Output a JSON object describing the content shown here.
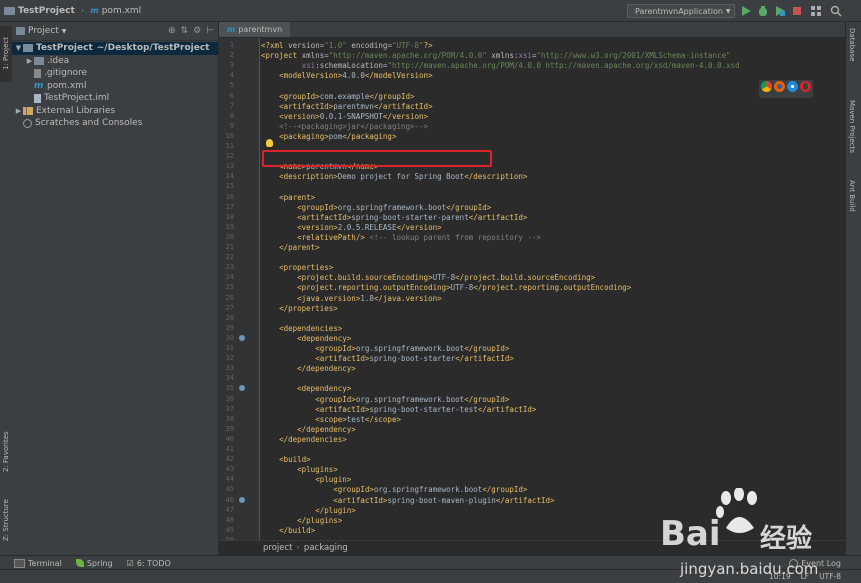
{
  "titlebar": {
    "project": "TestProject",
    "file": "pom.xml",
    "run_config": "ParentmvnApplication"
  },
  "left_strip": {
    "project_tab": "1: Project",
    "favorites_tab": "2: Favorites",
    "structure_tab": "Z: Structure"
  },
  "right_strip": {
    "database": "Database",
    "maven": "Maven Projects",
    "ant": "Ant Build"
  },
  "project_panel": {
    "title": "Project",
    "tree": [
      {
        "label": "TestProject",
        "suffix": "~/Desktop/TestProject",
        "indent": 0,
        "expanded": true,
        "icon": "folder-icon",
        "selected": true
      },
      {
        "label": ".idea",
        "indent": 1,
        "expanded": false,
        "icon": "folder-icon"
      },
      {
        "label": ".gitignore",
        "indent": 1,
        "icon": "file-icon"
      },
      {
        "label": "pom.xml",
        "indent": 1,
        "icon": "maven-icon"
      },
      {
        "label": "TestProject.iml",
        "indent": 1,
        "icon": "iml-icon"
      },
      {
        "label": "External Libraries",
        "indent": 0,
        "expanded": false,
        "icon": "library-icon"
      },
      {
        "label": "Scratches and Consoles",
        "indent": 0,
        "icon": "scratch-icon"
      }
    ]
  },
  "editor": {
    "tab": "parentmvn",
    "lines": [
      [
        [
          "tag",
          "<?xml "
        ],
        [
          "attr",
          "version"
        ],
        [
          "txt",
          "="
        ],
        [
          "str",
          "\"1.0\""
        ],
        [
          "attr",
          " encoding"
        ],
        [
          "txt",
          "="
        ],
        [
          "str",
          "\"UTF-8\""
        ],
        [
          "tag",
          "?>"
        ]
      ],
      [
        [
          "tag",
          "<project "
        ],
        [
          "attr",
          "xmlns"
        ],
        [
          "txt",
          "="
        ],
        [
          "str",
          "\"http://maven.apache.org/POM/4.0.0\""
        ],
        [
          "attr",
          " xmlns"
        ],
        [
          "txt",
          ":"
        ],
        [
          "ns",
          "xsi"
        ],
        [
          "txt",
          "="
        ],
        [
          "str",
          "\"http://www.w3.org/2001/XMLSchema-instance\""
        ]
      ],
      [
        [
          "txt",
          "         "
        ],
        [
          "ns",
          "xsi"
        ],
        [
          "attr",
          ":schemaLocation"
        ],
        [
          "txt",
          "="
        ],
        [
          "str",
          "\"http://maven.apache.org/POM/4.0.0 http://maven.apache.org/xsd/maven-4.0.0.xsd"
        ]
      ],
      [
        [
          "txt",
          "    "
        ],
        [
          "tag",
          "<modelVersion>"
        ],
        [
          "txt",
          "4.0.0"
        ],
        [
          "tag",
          "</modelVersion>"
        ]
      ],
      [],
      [
        [
          "txt",
          "    "
        ],
        [
          "tag",
          "<groupId>"
        ],
        [
          "txt",
          "com.example"
        ],
        [
          "tag",
          "</groupId>"
        ]
      ],
      [
        [
          "txt",
          "    "
        ],
        [
          "tag",
          "<artifactId>"
        ],
        [
          "txt",
          "parentmvn"
        ],
        [
          "tag",
          "</artifactId>"
        ]
      ],
      [
        [
          "txt",
          "    "
        ],
        [
          "tag",
          "<version>"
        ],
        [
          "txt",
          "0.0.1-SNAPSHOT"
        ],
        [
          "tag",
          "</version>"
        ]
      ],
      [
        [
          "txt",
          "    "
        ],
        [
          "cmt",
          "<!--<packaging>jar</packaging>-->"
        ]
      ],
      [
        [
          "txt",
          "    "
        ],
        [
          "tag",
          "<packaging>"
        ],
        [
          "txt",
          "pom"
        ],
        [
          "tag",
          "</packaging>"
        ]
      ],
      [],
      [],
      [
        [
          "txt",
          "    "
        ],
        [
          "tag",
          "<name>"
        ],
        [
          "txt",
          "parentmvn"
        ],
        [
          "tag",
          "</name>"
        ]
      ],
      [
        [
          "txt",
          "    "
        ],
        [
          "tag",
          "<description>"
        ],
        [
          "txt",
          "Demo project for Spring Boot"
        ],
        [
          "tag",
          "</description>"
        ]
      ],
      [],
      [
        [
          "txt",
          "    "
        ],
        [
          "tag",
          "<parent>"
        ]
      ],
      [
        [
          "txt",
          "        "
        ],
        [
          "tag",
          "<groupId>"
        ],
        [
          "txt",
          "org.springframework.boot"
        ],
        [
          "tag",
          "</groupId>"
        ]
      ],
      [
        [
          "txt",
          "        "
        ],
        [
          "tag",
          "<artifactId>"
        ],
        [
          "txt",
          "spring-boot-starter-parent"
        ],
        [
          "tag",
          "</artifactId>"
        ]
      ],
      [
        [
          "txt",
          "        "
        ],
        [
          "tag",
          "<version>"
        ],
        [
          "txt",
          "2.0.5.RELEASE"
        ],
        [
          "tag",
          "</version>"
        ]
      ],
      [
        [
          "txt",
          "        "
        ],
        [
          "tag",
          "<relativePath/>"
        ],
        [
          "cmt",
          " <!-- lookup parent from repository -->"
        ]
      ],
      [
        [
          "txt",
          "    "
        ],
        [
          "tag",
          "</parent>"
        ]
      ],
      [],
      [
        [
          "txt",
          "    "
        ],
        [
          "tag",
          "<properties>"
        ]
      ],
      [
        [
          "txt",
          "        "
        ],
        [
          "tag",
          "<project.build.sourceEncoding>"
        ],
        [
          "txt",
          "UTF-8"
        ],
        [
          "tag",
          "</project.build.sourceEncoding>"
        ]
      ],
      [
        [
          "txt",
          "        "
        ],
        [
          "tag",
          "<project.reporting.outputEncoding>"
        ],
        [
          "txt",
          "UTF-8"
        ],
        [
          "tag",
          "</project.reporting.outputEncoding>"
        ]
      ],
      [
        [
          "txt",
          "        "
        ],
        [
          "tag",
          "<java.version>"
        ],
        [
          "txt",
          "1.8"
        ],
        [
          "tag",
          "</java.version>"
        ]
      ],
      [
        [
          "txt",
          "    "
        ],
        [
          "tag",
          "</properties>"
        ]
      ],
      [],
      [
        [
          "txt",
          "    "
        ],
        [
          "tag",
          "<dependencies>"
        ]
      ],
      [
        [
          "txt",
          "        "
        ],
        [
          "tag",
          "<dependency>"
        ]
      ],
      [
        [
          "txt",
          "            "
        ],
        [
          "tag",
          "<groupId>"
        ],
        [
          "txt",
          "org.springframework.boot"
        ],
        [
          "tag",
          "</groupId>"
        ]
      ],
      [
        [
          "txt",
          "            "
        ],
        [
          "tag",
          "<artifactId>"
        ],
        [
          "txt",
          "spring-boot-starter"
        ],
        [
          "tag",
          "</artifactId>"
        ]
      ],
      [
        [
          "txt",
          "        "
        ],
        [
          "tag",
          "</dependency>"
        ]
      ],
      [],
      [
        [
          "txt",
          "        "
        ],
        [
          "tag",
          "<dependency>"
        ]
      ],
      [
        [
          "txt",
          "            "
        ],
        [
          "tag",
          "<groupId>"
        ],
        [
          "txt",
          "org.springframework.boot"
        ],
        [
          "tag",
          "</groupId>"
        ]
      ],
      [
        [
          "txt",
          "            "
        ],
        [
          "tag",
          "<artifactId>"
        ],
        [
          "txt",
          "spring-boot-starter-test"
        ],
        [
          "tag",
          "</artifactId>"
        ]
      ],
      [
        [
          "txt",
          "            "
        ],
        [
          "tag",
          "<scope>"
        ],
        [
          "txt",
          "test"
        ],
        [
          "tag",
          "</scope>"
        ]
      ],
      [
        [
          "txt",
          "        "
        ],
        [
          "tag",
          "</dependency>"
        ]
      ],
      [
        [
          "txt",
          "    "
        ],
        [
          "tag",
          "</dependencies>"
        ]
      ],
      [],
      [
        [
          "txt",
          "    "
        ],
        [
          "tag",
          "<build>"
        ]
      ],
      [
        [
          "txt",
          "        "
        ],
        [
          "tag",
          "<plugins>"
        ]
      ],
      [
        [
          "txt",
          "            "
        ],
        [
          "tag",
          "<plugin>"
        ]
      ],
      [
        [
          "txt",
          "                "
        ],
        [
          "tag",
          "<groupId>"
        ],
        [
          "txt",
          "org.springframework.boot"
        ],
        [
          "tag",
          "</groupId>"
        ]
      ],
      [
        [
          "txt",
          "                "
        ],
        [
          "tag",
          "<artifactId>"
        ],
        [
          "txt",
          "spring-boot-maven-plugin"
        ],
        [
          "tag",
          "</artifactId>"
        ]
      ],
      [
        [
          "txt",
          "            "
        ],
        [
          "tag",
          "</plugin>"
        ]
      ],
      [
        [
          "txt",
          "        "
        ],
        [
          "tag",
          "</plugins>"
        ]
      ],
      [
        [
          "txt",
          "    "
        ],
        [
          "tag",
          "</build>"
        ]
      ],
      [],
      []
    ],
    "breadcrumb": [
      "project",
      "packaging"
    ]
  },
  "bottom_tools": {
    "terminal": "Terminal",
    "spring": "Spring",
    "todo": "6: TODO",
    "event_log": "Event Log"
  },
  "status": {
    "position": "10:19",
    "line_sep": "LF",
    "encoding": "UTF-8"
  },
  "watermark": {
    "brand": "Bai",
    "brand_suffix": "经验",
    "url": "jingyan.baidu.com"
  },
  "colors": {
    "highlight_box": "#d8252b",
    "run_green": "#59a869"
  }
}
